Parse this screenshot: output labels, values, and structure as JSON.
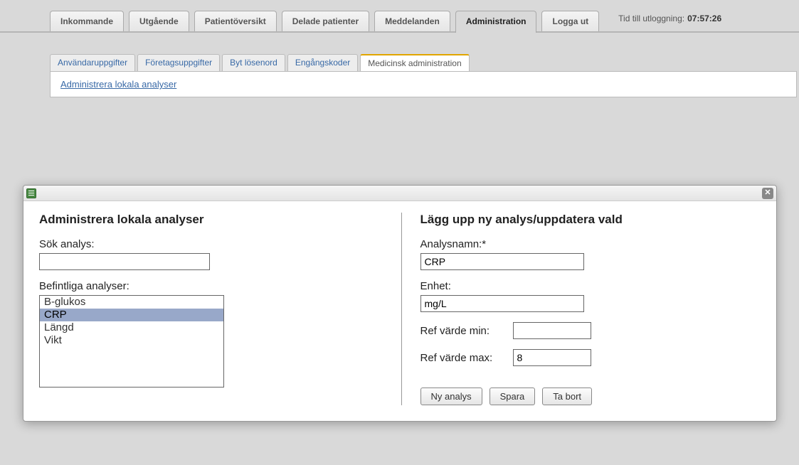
{
  "topTabs": [
    {
      "label": "Inkommande"
    },
    {
      "label": "Utgående"
    },
    {
      "label": "Patientöversikt"
    },
    {
      "label": "Delade patienter"
    },
    {
      "label": "Meddelanden"
    },
    {
      "label": "Administration",
      "active": true
    },
    {
      "label": "Logga ut"
    }
  ],
  "logoutTimer": {
    "label": "Tid till utloggning:",
    "value": "07:57:26"
  },
  "subTabs": [
    {
      "label": "Användaruppgifter"
    },
    {
      "label": "Företagsuppgifter"
    },
    {
      "label": "Byt lösenord"
    },
    {
      "label": "Engångskoder"
    },
    {
      "label": "Medicinsk administration",
      "active": true
    }
  ],
  "subBodyLink": "Administrera lokala analyser",
  "modal": {
    "left": {
      "title": "Administrera lokala analyser",
      "searchLabel": "Sök analys:",
      "searchValue": "",
      "listLabel": "Befintliga analyser:",
      "items": [
        {
          "label": "B-glukos"
        },
        {
          "label": "CRP",
          "selected": true
        },
        {
          "label": "Längd"
        },
        {
          "label": "Vikt"
        }
      ]
    },
    "right": {
      "title": "Lägg upp ny analys/uppdatera vald",
      "nameLabel": "Analysnamn:*",
      "nameValue": "CRP",
      "unitLabel": "Enhet:",
      "unitValue": "mg/L",
      "refMinLabel": "Ref värde min:",
      "refMinValue": "",
      "refMaxLabel": "Ref värde max:",
      "refMaxValue": "8",
      "buttons": {
        "new": "Ny analys",
        "save": "Spara",
        "delete": "Ta bort"
      }
    }
  }
}
